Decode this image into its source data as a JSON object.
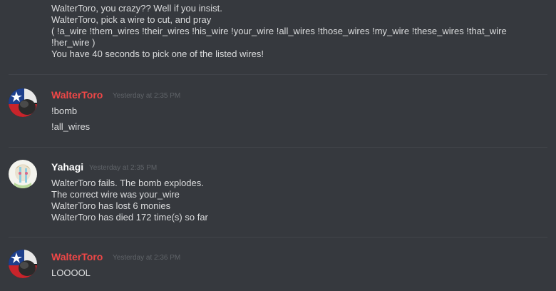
{
  "messages": [
    {
      "id": "m0",
      "lines": [
        "WalterToro, you crazy??  Well if you insist.",
        "WalterToro, pick a wire to cut, and pray",
        "( !a_wire !them_wires !their_wires !his_wire !your_wire !all_wires !those_wires !my_wire !these_wires !that_wire",
        "!her_wire )",
        "You have 40 seconds to pick one of the listed wires!"
      ]
    },
    {
      "id": "m1",
      "author": "WalterToro",
      "author_color": "#f04747",
      "timestamp": "Yesterday at 2:35 PM",
      "lines": [
        "!bomb",
        "!all_wires"
      ]
    },
    {
      "id": "m2",
      "author": "Yahagi",
      "author_color": "#ffffff",
      "timestamp": "Yesterday at 2:35 PM",
      "lines": [
        "WalterToro fails.  The bomb explodes.",
        "The correct wire was your_wire",
        "WalterToro has lost 6 monies",
        "WalterToro has died 172 time(s) so far"
      ]
    },
    {
      "id": "m3",
      "author": "WalterToro",
      "author_color": "#f04747",
      "timestamp": "Yesterday at 2:36 PM",
      "lines": [
        "LOOOOL"
      ]
    }
  ]
}
